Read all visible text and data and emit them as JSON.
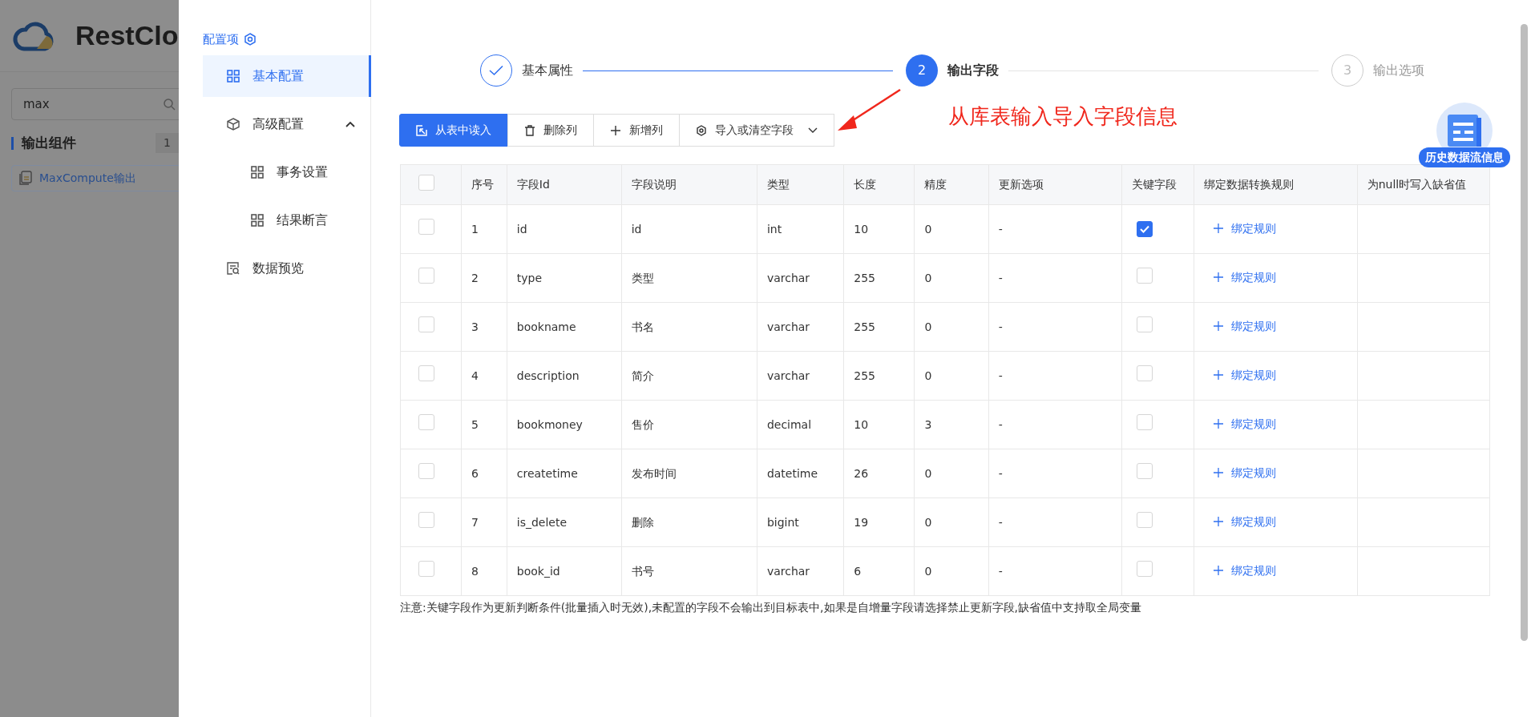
{
  "background_app": {
    "logo_text": "RestClo",
    "search": {
      "value": "max"
    },
    "group": {
      "title": "输出组件",
      "count": "1"
    },
    "items": [
      {
        "label": "MaxCompute输出"
      }
    ]
  },
  "config_nav": {
    "title": "配置项",
    "items": [
      {
        "label": "基本配置",
        "kind": "grid",
        "selected": true
      },
      {
        "label": "高级配置",
        "kind": "cube",
        "selected": false,
        "expanded": true,
        "children": [
          {
            "label": "事务设置",
            "kind": "grid",
            "selected": false
          },
          {
            "label": "结果断言",
            "kind": "grid",
            "selected": false
          }
        ]
      },
      {
        "label": "数据预览",
        "kind": "preview",
        "selected": false
      }
    ]
  },
  "steps": [
    {
      "label": "基本属性",
      "done": true,
      "selected": false
    },
    {
      "number": "2",
      "label": "输出字段",
      "done": false,
      "selected": true
    },
    {
      "number": "3",
      "label": "输出选项",
      "done": false,
      "selected": false
    }
  ],
  "toolbar": [
    {
      "label": "从表中读入",
      "kind": "import",
      "primary": true
    },
    {
      "label": "删除列",
      "kind": "trash",
      "primary": false
    },
    {
      "label": "新增列",
      "kind": "plus",
      "primary": false
    },
    {
      "label": "导入或清空字段",
      "kind": "gear",
      "primary": false,
      "dropdown": true
    }
  ],
  "annotation": {
    "text": "从库表输入导入字段信息"
  },
  "floating_badge": {
    "label": "历史数据流信息"
  },
  "table": {
    "all_checked": false,
    "columns": [
      "序号",
      "字段Id",
      "字段说明",
      "类型",
      "长度",
      "精度",
      "更新选项",
      "关键字段",
      "绑定数据转换规则",
      "为null时写入缺省值"
    ],
    "rows": [
      {
        "checked": false,
        "index": "1",
        "field_id": "id",
        "description": "id",
        "type": "int",
        "length": "10",
        "precision": "0",
        "update_option": "-",
        "key": true,
        "rule": "绑定规则"
      },
      {
        "checked": false,
        "index": "2",
        "field_id": "type",
        "description": "类型",
        "type": "varchar",
        "length": "255",
        "precision": "0",
        "update_option": "-",
        "key": false,
        "rule": "绑定规则"
      },
      {
        "checked": false,
        "index": "3",
        "field_id": "bookname",
        "description": "书名",
        "type": "varchar",
        "length": "255",
        "precision": "0",
        "update_option": "-",
        "key": false,
        "rule": "绑定规则"
      },
      {
        "checked": false,
        "index": "4",
        "field_id": "description",
        "description": "简介",
        "type": "varchar",
        "length": "255",
        "precision": "0",
        "update_option": "-",
        "key": false,
        "rule": "绑定规则"
      },
      {
        "checked": false,
        "index": "5",
        "field_id": "bookmoney",
        "description": "售价",
        "type": "decimal",
        "length": "10",
        "precision": "3",
        "update_option": "-",
        "key": false,
        "rule": "绑定规则"
      },
      {
        "checked": false,
        "index": "6",
        "field_id": "createtime",
        "description": "发布时间",
        "type": "datetime",
        "length": "26",
        "precision": "0",
        "update_option": "-",
        "key": false,
        "rule": "绑定规则"
      },
      {
        "checked": false,
        "index": "7",
        "field_id": "is_delete",
        "description": "删除",
        "type": "bigint",
        "length": "19",
        "precision": "0",
        "update_option": "-",
        "key": false,
        "rule": "绑定规则"
      },
      {
        "checked": false,
        "index": "8",
        "field_id": "book_id",
        "description": "书号",
        "type": "varchar",
        "length": "6",
        "precision": "0",
        "update_option": "-",
        "key": false,
        "rule": "绑定规则"
      }
    ]
  },
  "note": "注意:关键字段作为更新判断条件(批量插入时无效),未配置的字段不会输出到目标表中,如果是自增量字段请选择禁止更新字段,缺省值中支持取全局变量"
}
